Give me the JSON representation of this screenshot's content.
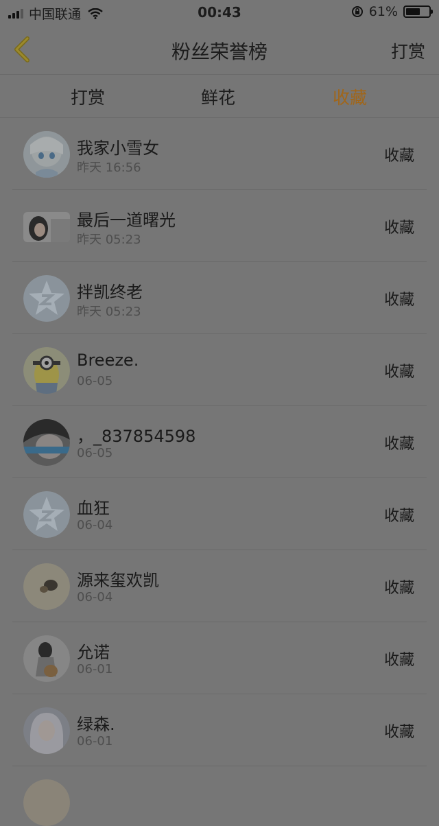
{
  "status_bar": {
    "carrier": "中国联通",
    "time": "00:43",
    "battery": "61%",
    "battery_level": 0.61
  },
  "nav": {
    "title": "粉丝荣誉榜",
    "action": "打赏"
  },
  "tabs": [
    {
      "label": "打赏",
      "active": false
    },
    {
      "label": "鲜花",
      "active": false
    },
    {
      "label": "收藏",
      "active": true
    }
  ],
  "accent_color": "#a0661a",
  "rows": [
    {
      "name": "我家小雪女",
      "time": "昨天 16:56",
      "action": "收藏",
      "avatar": "anime-girl-avatar"
    },
    {
      "name": "最后一道曙光",
      "time": "昨天 05:23",
      "action": "收藏",
      "avatar": "photo-avatar"
    },
    {
      "name": "拌凯终老",
      "time": "昨天 05:23",
      "action": "收藏",
      "avatar": "default-star-avatar"
    },
    {
      "name": "Breeze.",
      "time": "06-05",
      "action": "收藏",
      "avatar": "minion-avatar"
    },
    {
      "name": "，_837854598",
      "time": "06-05",
      "action": "收藏",
      "avatar": "photo-avatar"
    },
    {
      "name": "血狂",
      "time": "06-04",
      "action": "收藏",
      "avatar": "default-star-avatar"
    },
    {
      "name": "源来玺欢凯",
      "time": "06-04",
      "action": "收藏",
      "avatar": "photo-avatar"
    },
    {
      "name": "允诺",
      "time": "06-01",
      "action": "收藏",
      "avatar": "photo-avatar"
    },
    {
      "name": "绿森.",
      "time": "06-01",
      "action": "收藏",
      "avatar": "photo-avatar"
    }
  ]
}
